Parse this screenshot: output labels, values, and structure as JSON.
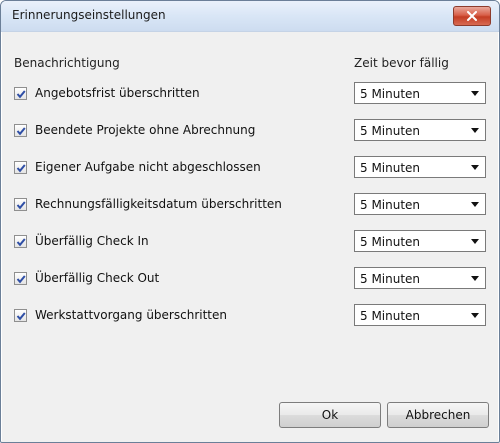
{
  "window": {
    "title": "Erinnerungseinstellungen"
  },
  "headers": {
    "notification": "Benachrichtigung",
    "time_before_due": "Zeit bevor fällig"
  },
  "rows": [
    {
      "label": "Angebotsfrist überschritten",
      "checked": true,
      "value": "5 Minuten"
    },
    {
      "label": "Beendete Projekte ohne Abrechnung",
      "checked": true,
      "value": "5 Minuten"
    },
    {
      "label": "Eigener Aufgabe nicht abgeschlossen",
      "checked": true,
      "value": "5 Minuten"
    },
    {
      "label": "Rechnungsfälligkeitsdatum  überschritten",
      "checked": true,
      "value": "5 Minuten"
    },
    {
      "label": "Überfällig Check In",
      "checked": true,
      "value": "5 Minuten"
    },
    {
      "label": "Überfällig Check Out",
      "checked": true,
      "value": "5 Minuten"
    },
    {
      "label": "Werkstattvorgang überschritten",
      "checked": true,
      "value": "5 Minuten"
    }
  ],
  "buttons": {
    "ok": "Ok",
    "cancel": "Abbrechen"
  },
  "colors": {
    "close_button": "#c43d24",
    "titlebar": "#d9e6f6",
    "dialog_bg": "#f0f0f0",
    "check": "#2f4fa6"
  }
}
